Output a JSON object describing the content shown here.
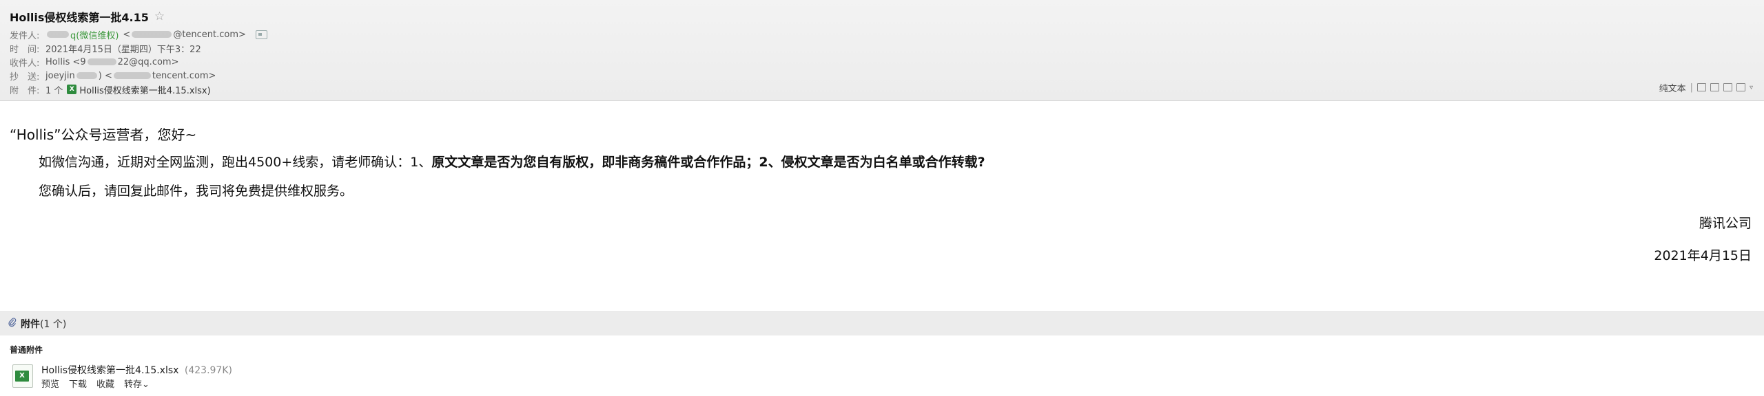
{
  "header": {
    "subject": "Hollis侵权线索第一批4.15",
    "star_icon": "☆",
    "rows": {
      "from_label": "发件人:",
      "from_name": "q(微信维权)",
      "from_email_prefix": "<",
      "from_email_suffix": "@tencent.com>",
      "time_label": "时　间:",
      "time_value": "2021年4月15日（星期四）下午3：22",
      "to_label": "收件人:",
      "to_value_prefix": "Hollis <9",
      "to_value_suffix": "22@qq.com>",
      "cc_label": "抄　送:",
      "cc_value_prefix": "joeyjin",
      "cc_value_mid": ") <",
      "cc_value_suffix": "tencent.com>",
      "attach_label": "附　件:",
      "attach_count": "1 个",
      "attach_icon": "X",
      "attach_name": "Hollis侵权线索第一批4.15.xlsx)"
    },
    "toolbar": {
      "plain_text": "纯文本",
      "separator": "|",
      "chevron": "▿"
    }
  },
  "body": {
    "greeting": "“Hollis”公众号运营者，您好~",
    "para1_normal": "如微信沟通，近期对全网监测，跑出4500+线索，请老师确认：1、",
    "para1_bold1": "原文文章是否为您自有版权，即非商务稿件或合作作品",
    "para1_sep": "；2、",
    "para1_bold2": "侵权文章是否为白名单或合作转载?",
    "para2": "您确认后，请回复此邮件，我司将免费提供维权服务。",
    "sign_company": "腾讯公司",
    "sign_date": "2021年4月15日"
  },
  "attachments": {
    "bar_title": "附件",
    "bar_count": "(1 个)",
    "section_title": "普通附件",
    "file_icon_label": "X",
    "file_name": "Hollis侵权线索第一批4.15.xlsx",
    "file_size": "(423.97K)",
    "actions": {
      "preview": "预览",
      "download": "下载",
      "favorite": "收藏",
      "save_to": "转存⌄"
    }
  },
  "colors": {
    "sender_green": "#3f9a3f",
    "excel_green": "#2e8b3e"
  }
}
